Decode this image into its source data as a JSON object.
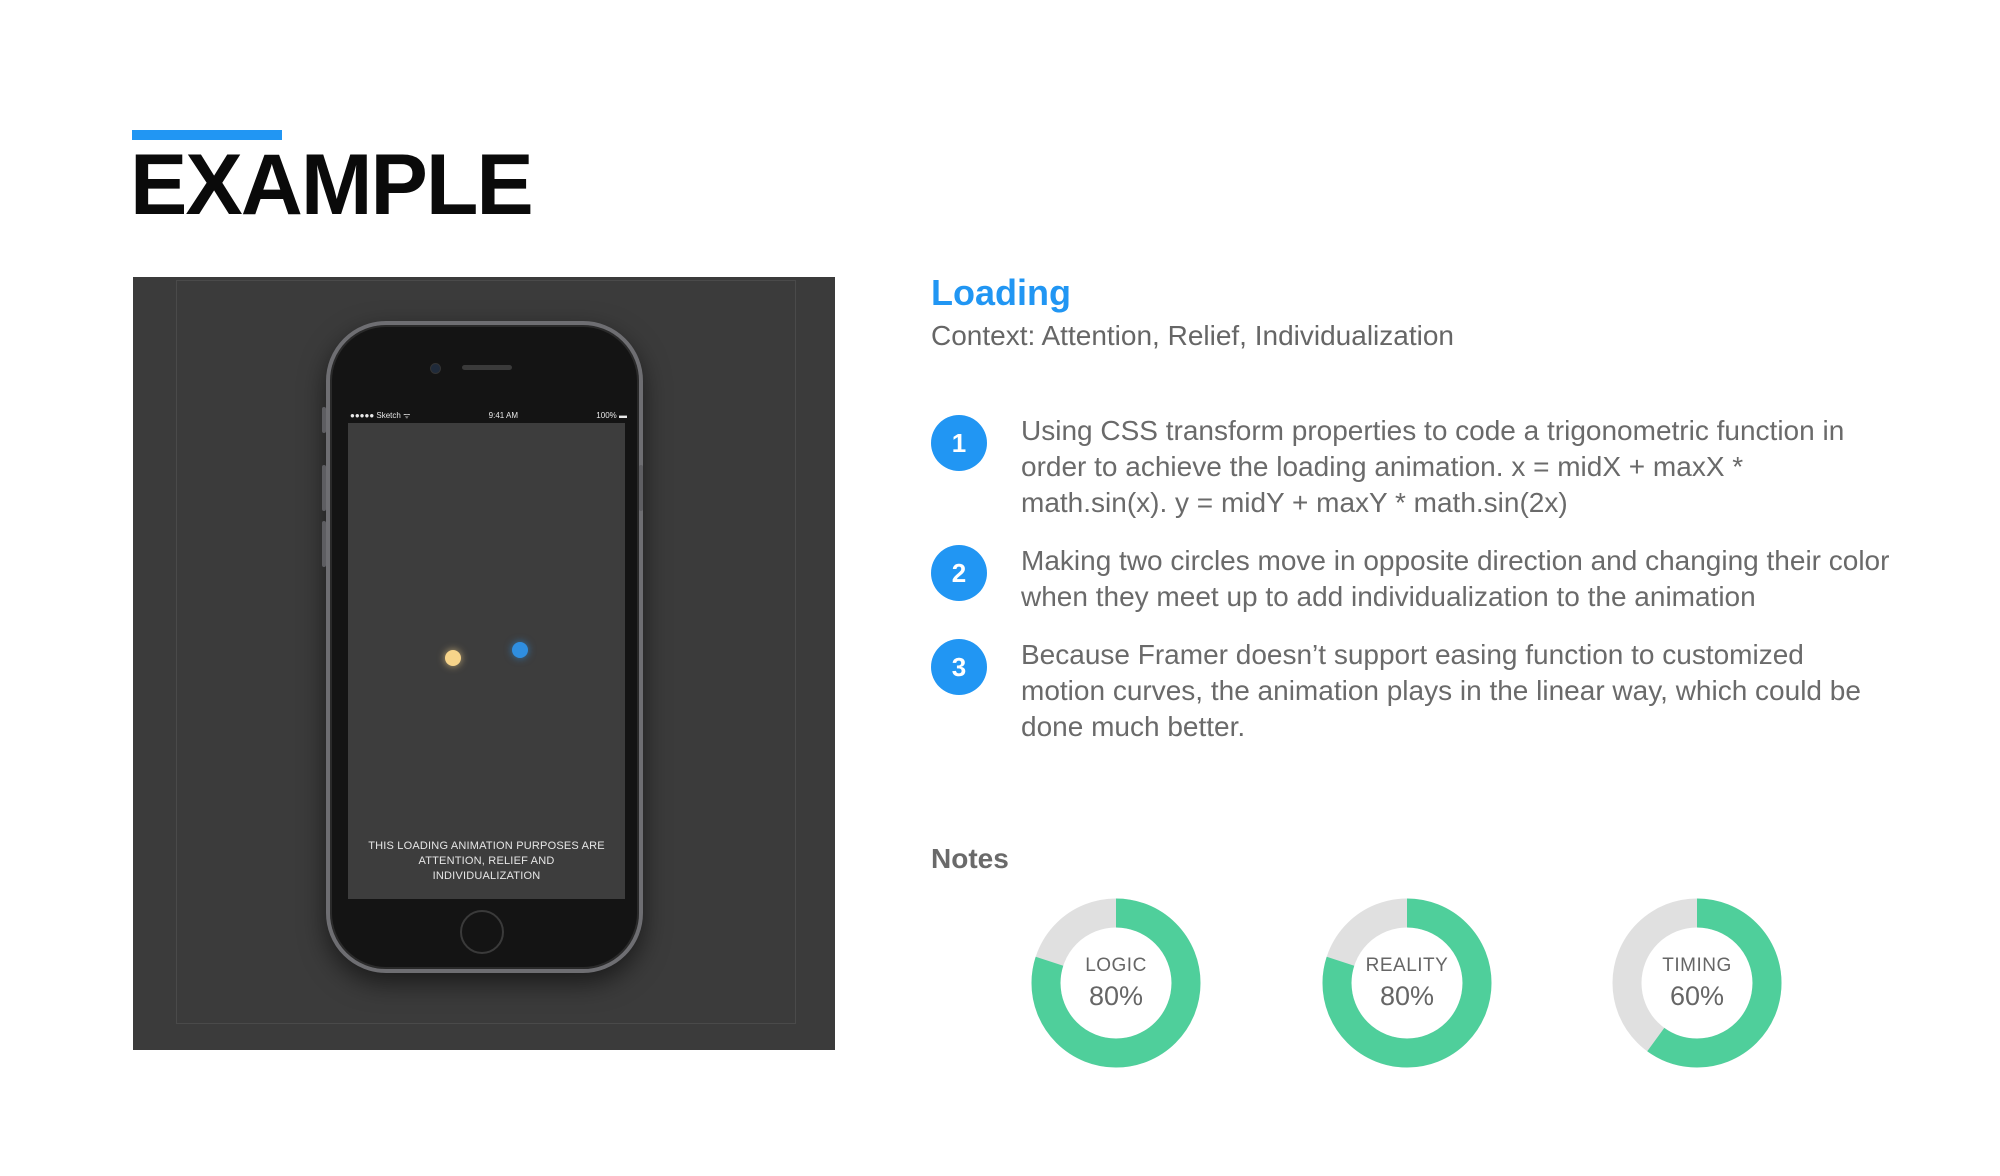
{
  "page": {
    "title": "EXAMPLE"
  },
  "mockup": {
    "status_left": "●●●●● Sketch ᯤ",
    "status_time": "9:41 AM",
    "status_right": "100% ▬",
    "caption": "THIS LOADING ANIMATION PURPOSES ARE ATTENTION, RELIEF AND INDIVIDUALIZATION"
  },
  "section": {
    "title": "Loading",
    "subtitle": "Context: Attention, Relief, Individualization"
  },
  "steps": [
    {
      "number": "1",
      "text": "Using CSS transform properties to code a trigonometric function in order to achieve the loading animation. x = midX + maxX * math.sin(x). y = midY + maxY * math.sin(2x)"
    },
    {
      "number": "2",
      "text": "Making two circles move in opposite direction and changing their color when they meet up to add individualization to the animation"
    },
    {
      "number": "3",
      "text": "Because Framer doesn’t support easing function to customized motion curves, the animation plays in the linear way, which could be done much better."
    }
  ],
  "notes": {
    "heading": "Notes",
    "items": [
      {
        "label": "LOGIC",
        "value": "80%",
        "fraction": 0.8
      },
      {
        "label": "REALITY",
        "value": "80%",
        "fraction": 0.8
      },
      {
        "label": "TIMING",
        "value": "60%",
        "fraction": 0.6
      }
    ],
    "colors": {
      "filled": "#4fcf9b",
      "empty": "#e0e0e0"
    }
  }
}
